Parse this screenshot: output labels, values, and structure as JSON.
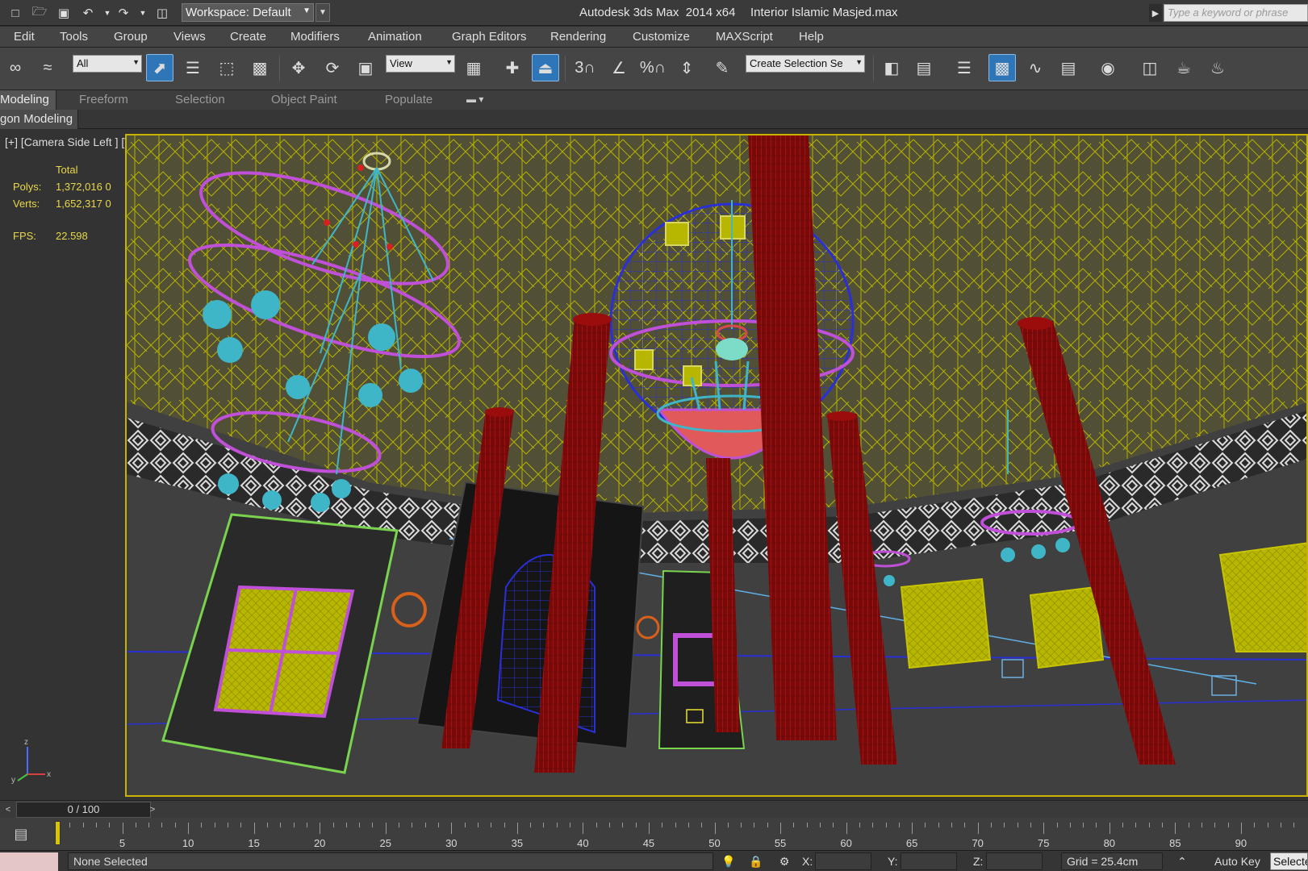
{
  "titlebar": {
    "workspace_value": "Workspace: Default",
    "app_title": "Autodesk 3ds Max  2014 x64",
    "file_title": "Interior Islamic Masjed.max",
    "search_placeholder": "Type a keyword or phrase"
  },
  "menu": {
    "items": [
      "Edit",
      "Tools",
      "Group",
      "Views",
      "Create",
      "Modifiers",
      "Animation",
      "Graph Editors",
      "Rendering",
      "Customize",
      "MAXScript",
      "Help"
    ]
  },
  "toolbar": {
    "selection_filter": "All",
    "reference_coord": "View",
    "named_selection_placeholder": "Create Selection Se",
    "snap_labels": {
      "snap3": "3",
      "angle_snap": "",
      "percent_snap": "%",
      "spinner_snap": ""
    }
  },
  "ribbon": {
    "tabs": [
      "Modeling",
      "Freeform",
      "Selection",
      "Object Paint",
      "Populate"
    ],
    "sub_label": "gon Modeling"
  },
  "viewport": {
    "label": "[+] [Camera Side Left ] [Wireframe ]",
    "stats": {
      "header": "Total",
      "polys_label": "Polys:",
      "polys_value": "1,372,016",
      "polys_sel": "0",
      "verts_label": "Verts:",
      "verts_value": "1,652,317",
      "verts_sel": "0",
      "fps_label": "FPS:",
      "fps_value": "22.598"
    },
    "axis": {
      "z": "z",
      "x": "x",
      "y": "y"
    }
  },
  "timeline": {
    "frame_display": "0 / 100",
    "ticks": [
      "5",
      "10",
      "15",
      "20",
      "25",
      "30",
      "35",
      "40",
      "45",
      "50",
      "55",
      "60",
      "65",
      "70",
      "75",
      "80",
      "85",
      "90"
    ]
  },
  "statusbar": {
    "selection_text": "None Selected",
    "x_label": "X:",
    "y_label": "Y:",
    "z_label": "Z:",
    "grid_text": "Grid = 25.4cm",
    "autokey_label": "Auto Key",
    "selected_label": "Selected"
  },
  "colors": {
    "viewport_border": "#c8b400",
    "wire_ceiling": "#b5b000",
    "column_red": "#9b0c0c",
    "dome_blue": "#2a2fd6",
    "chandelier_magenta": "#c050d8",
    "chandelier_cyan": "#3fb6c8",
    "active_button": "#2f76b8"
  }
}
